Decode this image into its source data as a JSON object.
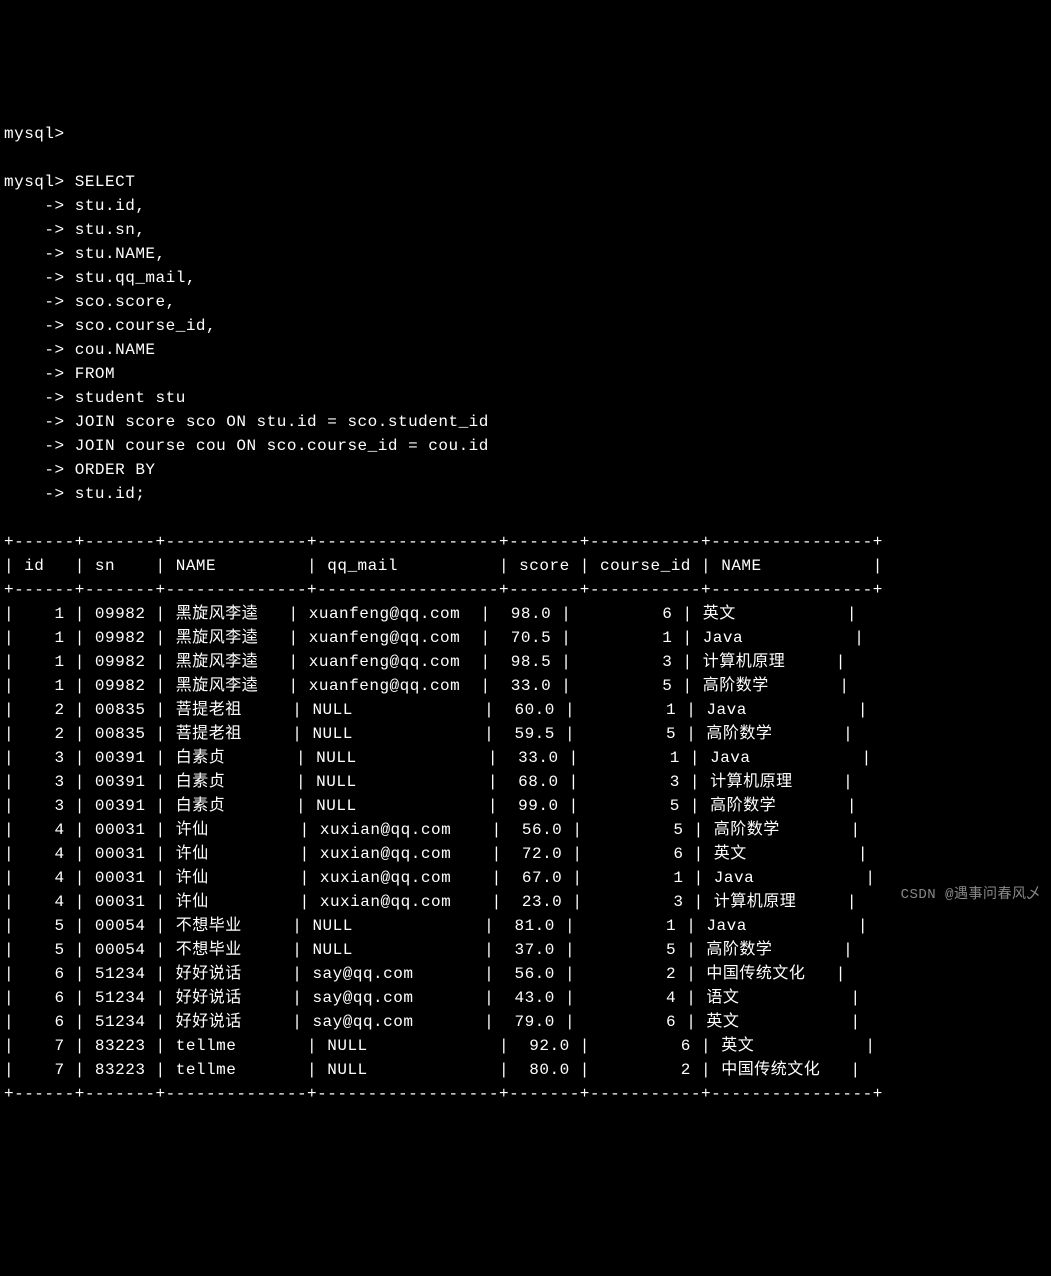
{
  "prompt_header": "mysql>",
  "query_lines": [
    "mysql> SELECT",
    "    -> stu.id,",
    "    -> stu.sn,",
    "    -> stu.NAME,",
    "    -> stu.qq_mail,",
    "    -> sco.score,",
    "    -> sco.course_id,",
    "    -> cou.NAME",
    "    -> FROM",
    "    -> student stu",
    "    -> JOIN score sco ON stu.id = sco.student_id",
    "    -> JOIN course cou ON sco.course_id = cou.id",
    "    -> ORDER BY",
    "    -> stu.id;"
  ],
  "separator": "+------+-------+--------------+------------------+-------+-----------+----------------+",
  "header": "| id   | sn    | NAME         | qq_mail          | score | course_id | NAME           |",
  "columns": [
    "id",
    "sn",
    "NAME",
    "qq_mail",
    "score",
    "course_id",
    "NAME"
  ],
  "rows": [
    {
      "id": "1",
      "sn": "09982",
      "name": "黑旋风李逵",
      "qq_mail": "xuanfeng@qq.com",
      "score": "98.0",
      "course_id": "6",
      "cname": "英文"
    },
    {
      "id": "1",
      "sn": "09982",
      "name": "黑旋风李逵",
      "qq_mail": "xuanfeng@qq.com",
      "score": "70.5",
      "course_id": "1",
      "cname": "Java"
    },
    {
      "id": "1",
      "sn": "09982",
      "name": "黑旋风李逵",
      "qq_mail": "xuanfeng@qq.com",
      "score": "98.5",
      "course_id": "3",
      "cname": "计算机原理"
    },
    {
      "id": "1",
      "sn": "09982",
      "name": "黑旋风李逵",
      "qq_mail": "xuanfeng@qq.com",
      "score": "33.0",
      "course_id": "5",
      "cname": "高阶数学"
    },
    {
      "id": "2",
      "sn": "00835",
      "name": "菩提老祖",
      "qq_mail": "NULL",
      "score": "60.0",
      "course_id": "1",
      "cname": "Java"
    },
    {
      "id": "2",
      "sn": "00835",
      "name": "菩提老祖",
      "qq_mail": "NULL",
      "score": "59.5",
      "course_id": "5",
      "cname": "高阶数学"
    },
    {
      "id": "3",
      "sn": "00391",
      "name": "白素贞",
      "qq_mail": "NULL",
      "score": "33.0",
      "course_id": "1",
      "cname": "Java"
    },
    {
      "id": "3",
      "sn": "00391",
      "name": "白素贞",
      "qq_mail": "NULL",
      "score": "68.0",
      "course_id": "3",
      "cname": "计算机原理"
    },
    {
      "id": "3",
      "sn": "00391",
      "name": "白素贞",
      "qq_mail": "NULL",
      "score": "99.0",
      "course_id": "5",
      "cname": "高阶数学"
    },
    {
      "id": "4",
      "sn": "00031",
      "name": "许仙",
      "qq_mail": "xuxian@qq.com",
      "score": "56.0",
      "course_id": "5",
      "cname": "高阶数学"
    },
    {
      "id": "4",
      "sn": "00031",
      "name": "许仙",
      "qq_mail": "xuxian@qq.com",
      "score": "72.0",
      "course_id": "6",
      "cname": "英文"
    },
    {
      "id": "4",
      "sn": "00031",
      "name": "许仙",
      "qq_mail": "xuxian@qq.com",
      "score": "67.0",
      "course_id": "1",
      "cname": "Java"
    },
    {
      "id": "4",
      "sn": "00031",
      "name": "许仙",
      "qq_mail": "xuxian@qq.com",
      "score": "23.0",
      "course_id": "3",
      "cname": "计算机原理"
    },
    {
      "id": "5",
      "sn": "00054",
      "name": "不想毕业",
      "qq_mail": "NULL",
      "score": "81.0",
      "course_id": "1",
      "cname": "Java"
    },
    {
      "id": "5",
      "sn": "00054",
      "name": "不想毕业",
      "qq_mail": "NULL",
      "score": "37.0",
      "course_id": "5",
      "cname": "高阶数学"
    },
    {
      "id": "6",
      "sn": "51234",
      "name": "好好说话",
      "qq_mail": "say@qq.com",
      "score": "56.0",
      "course_id": "2",
      "cname": "中国传统文化"
    },
    {
      "id": "6",
      "sn": "51234",
      "name": "好好说话",
      "qq_mail": "say@qq.com",
      "score": "43.0",
      "course_id": "4",
      "cname": "语文"
    },
    {
      "id": "6",
      "sn": "51234",
      "name": "好好说话",
      "qq_mail": "say@qq.com",
      "score": "79.0",
      "course_id": "6",
      "cname": "英文"
    },
    {
      "id": "7",
      "sn": "83223",
      "name": "tellme",
      "qq_mail": "NULL",
      "score": "92.0",
      "course_id": "6",
      "cname": "英文"
    },
    {
      "id": "7",
      "sn": "83223",
      "name": "tellme",
      "qq_mail": "NULL",
      "score": "80.0",
      "course_id": "2",
      "cname": "中国传统文化"
    }
  ],
  "watermark": "CSDN @遇事问春风乄"
}
